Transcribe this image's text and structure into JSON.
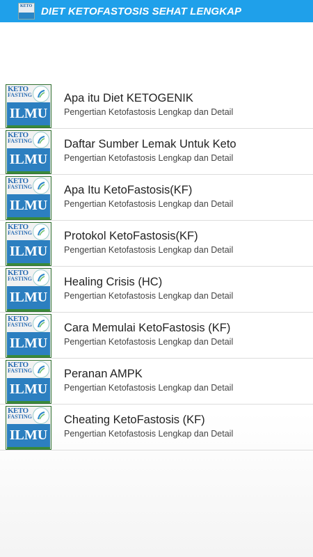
{
  "appbar": {
    "title": "DIET KETOFASTOSIS SEHAT LENGKAP",
    "logo_icon": "app-logo-icon",
    "color": "#1fa0ea"
  },
  "thumbnail": {
    "line1": "KETO",
    "line2": "FASTING",
    "main": "ILMU"
  },
  "items": [
    {
      "title": "Apa itu Diet KETOGENIK",
      "subtitle": "Pengertian Ketofastosis Lengkap dan Detail"
    },
    {
      "title": "Daftar Sumber Lemak Untuk Keto",
      "subtitle": "Pengertian Ketofastosis Lengkap dan Detail"
    },
    {
      "title": "Apa Itu KetoFastosis(KF)",
      "subtitle": "Pengertian Ketofastosis Lengkap dan Detail"
    },
    {
      "title": "Protokol KetoFastosis(KF)",
      "subtitle": "Pengertian Ketofastosis Lengkap dan Detail"
    },
    {
      "title": "Healing Crisis (HC)",
      "subtitle": "Pengertian Ketofastosis Lengkap dan Detail"
    },
    {
      "title": "Cara Memulai KetoFastosis (KF)",
      "subtitle": "Pengertian Ketofastosis Lengkap dan Detail"
    },
    {
      "title": "Peranan AMPK",
      "subtitle": "Pengertian Ketofastosis Lengkap dan Detail"
    },
    {
      "title": "Cheating KetoFastosis (KF)",
      "subtitle": "Pengertian Ketofastosis Lengkap dan Detail"
    }
  ]
}
